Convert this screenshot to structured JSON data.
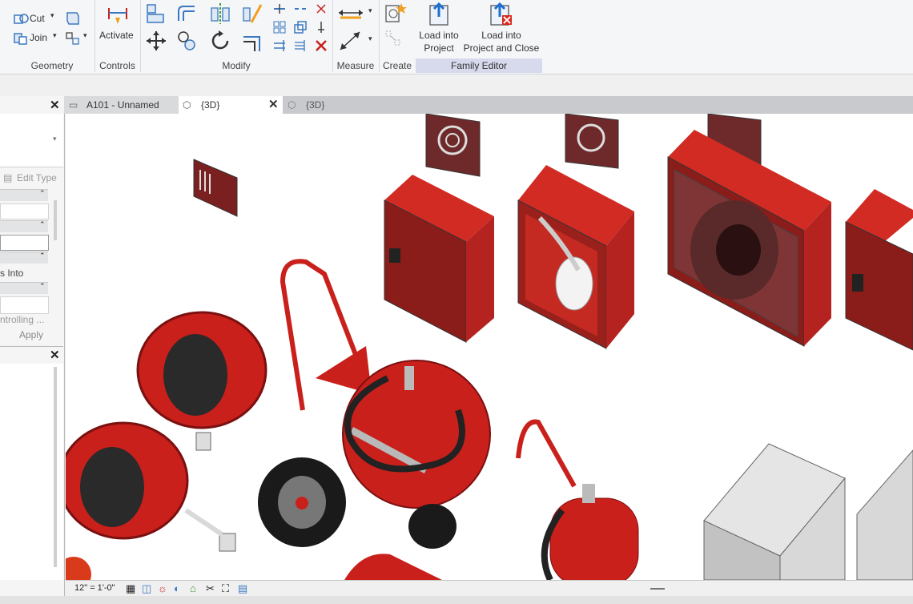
{
  "ribbon": {
    "geometry": {
      "label": "Geometry",
      "cut_label": "Cut",
      "join_label": "Join"
    },
    "controls": {
      "label": "Controls",
      "activate_label": "Activate"
    },
    "modify": {
      "label": "Modify"
    },
    "measure": {
      "label": "Measure"
    },
    "create": {
      "label": "Create"
    },
    "family_editor": {
      "label": "Family Editor",
      "load_project_line1": "Load into",
      "load_project_line2": "Project",
      "load_close_line1": "Load into",
      "load_close_line2": "Project and Close"
    }
  },
  "tabs": [
    {
      "label": "A101 - Unnamed"
    },
    {
      "label": "{3D}"
    },
    {
      "label": "{3D}"
    }
  ],
  "properties": {
    "edit_type_label": "Edit Type",
    "row_into": "s Into",
    "row_controlling": "ntrolling ...",
    "apply_label": "Apply"
  },
  "status": {
    "scale": "12\" = 1'-0\""
  },
  "colors": {
    "accent_red": "#c9201c",
    "ribbon_bg": "#f5f6f7",
    "family_editor_bg": "#d7d9ed",
    "canvas_bg": "#ffffff"
  }
}
